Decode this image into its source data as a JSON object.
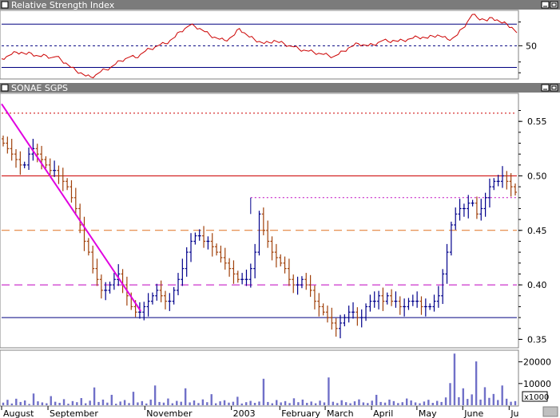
{
  "panels": {
    "rsi": {
      "title": "Relative Strength Index"
    },
    "price": {
      "title": "SONAE SGPS"
    },
    "volume": {
      "multiplier": "x1000"
    }
  },
  "colors": {
    "title_bar": "#7b7b7b",
    "up_bar": "#00008b",
    "down_bar": "#a0400a",
    "rsi_line": "#cc0000",
    "trendline": "#e000e0",
    "volume_fill": "#7070c8",
    "navy_line": "#000080",
    "red_line": "#cc0000",
    "orange_dash": "#e07020",
    "magenta_dash": "#c000c0",
    "red_dots": "#cc0000"
  },
  "chart_data": [
    {
      "type": "line",
      "panel": "rsi",
      "title": "Relative Strength Index",
      "ytick_labels": [
        "50"
      ],
      "ylim": [
        20,
        82
      ],
      "reference_lines": [
        {
          "value": 70,
          "style": "solid",
          "color": "navy"
        },
        {
          "value": 50,
          "style": "dashed",
          "color": "navy"
        },
        {
          "value": 30,
          "style": "solid",
          "color": "navy"
        }
      ],
      "series": [
        {
          "values": [
            38,
            40,
            42,
            44,
            44,
            42,
            43,
            41,
            40,
            41,
            39,
            40,
            37,
            34,
            30,
            27,
            25,
            22,
            21,
            23,
            26,
            28,
            30,
            33,
            36,
            38,
            40,
            39,
            42,
            45,
            47,
            49,
            51,
            52,
            55,
            58,
            63,
            66,
            69,
            68,
            66,
            63,
            60,
            58,
            56,
            55,
            57,
            60,
            66,
            62,
            58,
            56,
            54,
            52,
            53,
            55,
            53,
            52,
            50,
            49,
            47,
            46,
            45,
            44,
            43,
            42,
            41,
            40,
            42,
            45,
            48,
            50,
            52,
            51,
            50,
            51,
            53,
            55,
            54,
            55,
            54,
            55,
            56,
            57,
            58,
            58,
            57,
            59,
            60,
            58,
            56,
            57,
            60,
            66,
            72,
            79,
            76,
            75,
            73,
            76,
            74,
            71,
            70,
            67,
            62
          ]
        }
      ]
    },
    {
      "type": "bar",
      "subtype": "ohlc",
      "panel": "price",
      "title": "SONAE SGPS",
      "xlabel": "",
      "ylabel": "",
      "ylim": [
        0.343,
        0.575
      ],
      "ytick_labels": [
        "0.55",
        "0.50",
        "0.45",
        "0.40",
        "0.35"
      ],
      "x_tick_labels": [
        "August",
        "September",
        "November",
        "2003",
        "February",
        "March",
        "April",
        "May",
        "June",
        "Ju"
      ],
      "close": [
        0.53,
        0.525,
        0.52,
        0.515,
        0.51,
        0.51,
        0.52,
        0.525,
        0.52,
        0.515,
        0.51,
        0.505,
        0.505,
        0.5,
        0.495,
        0.49,
        0.48,
        0.47,
        0.455,
        0.44,
        0.43,
        0.415,
        0.405,
        0.395,
        0.395,
        0.4,
        0.405,
        0.41,
        0.4,
        0.39,
        0.38,
        0.375,
        0.375,
        0.38,
        0.385,
        0.39,
        0.395,
        0.39,
        0.385,
        0.385,
        0.395,
        0.405,
        0.415,
        0.43,
        0.44,
        0.445,
        0.445,
        0.44,
        0.44,
        0.435,
        0.43,
        0.425,
        0.42,
        0.415,
        0.41,
        0.405,
        0.405,
        0.405,
        0.415,
        0.43,
        0.465,
        0.45,
        0.44,
        0.43,
        0.425,
        0.42,
        0.415,
        0.405,
        0.4,
        0.4,
        0.405,
        0.4,
        0.395,
        0.385,
        0.38,
        0.375,
        0.37,
        0.365,
        0.36,
        0.365,
        0.37,
        0.375,
        0.375,
        0.37,
        0.37,
        0.38,
        0.385,
        0.385,
        0.39,
        0.385,
        0.39,
        0.385,
        0.385,
        0.38,
        0.38,
        0.385,
        0.385,
        0.385,
        0.38,
        0.38,
        0.38,
        0.385,
        0.39,
        0.41,
        0.43,
        0.455,
        0.465,
        0.47,
        0.47,
        0.475,
        0.475,
        0.465,
        0.47,
        0.48,
        0.49,
        0.495,
        0.495,
        0.5,
        0.495,
        0.49,
        0.485
      ],
      "reference_lines": [
        {
          "value": 0.5575,
          "style": "dotted",
          "color": "red"
        },
        {
          "value": 0.5,
          "style": "solid",
          "color": "red"
        },
        {
          "value": 0.48,
          "style": "dotted",
          "color": "magenta",
          "partial": true
        },
        {
          "value": 0.45,
          "style": "dashed",
          "color": "orange"
        },
        {
          "value": 0.4,
          "style": "dashed",
          "color": "magenta"
        },
        {
          "value": 0.37,
          "style": "solid",
          "color": "navy"
        }
      ],
      "trendline": {
        "from": [
          0.0,
          0.566
        ],
        "to": [
          0.27,
          0.376
        ]
      }
    },
    {
      "type": "bar",
      "panel": "volume",
      "ylim": [
        0,
        25000
      ],
      "ytick_labels": [
        "20000",
        "10000"
      ],
      "volume_multiplier": "x1000",
      "values": [
        1200,
        2500,
        800,
        3000,
        1500,
        2200,
        600,
        5400,
        1800,
        1300,
        900,
        4200,
        1600,
        1100,
        2800,
        700,
        1900,
        1400,
        3300,
        900,
        2100,
        8200,
        1500,
        2600,
        1200,
        4800,
        700,
        1700,
        2400,
        1000,
        6200,
        1300,
        1900,
        800,
        2600,
        9100,
        1500,
        1200,
        3100,
        900,
        2000,
        1600,
        7800,
        1300,
        2200,
        1000,
        2700,
        1400,
        5100,
        900,
        1800,
        2300,
        1200,
        1600,
        3900,
        800,
        1400,
        2000,
        1100,
        1700,
        12200,
        1500,
        900,
        2400,
        1300,
        1900,
        1000,
        3200,
        1400,
        2600,
        1100,
        1700,
        900,
        2100,
        1300,
        12800,
        1600,
        1000,
        2300,
        1400,
        900,
        1800,
        2700,
        1300,
        1000,
        2100,
        4800,
        1500,
        1200,
        2600,
        1900,
        1000,
        1400,
        3100,
        2200,
        1300,
        900,
        1700,
        2500,
        1100,
        2000,
        1500,
        3600,
        10200,
        23800,
        3700,
        7800,
        2900,
        5000,
        20200,
        2600,
        8300,
        3400,
        5200,
        2400,
        9100,
        3000,
        1600,
        1900
      ]
    }
  ]
}
